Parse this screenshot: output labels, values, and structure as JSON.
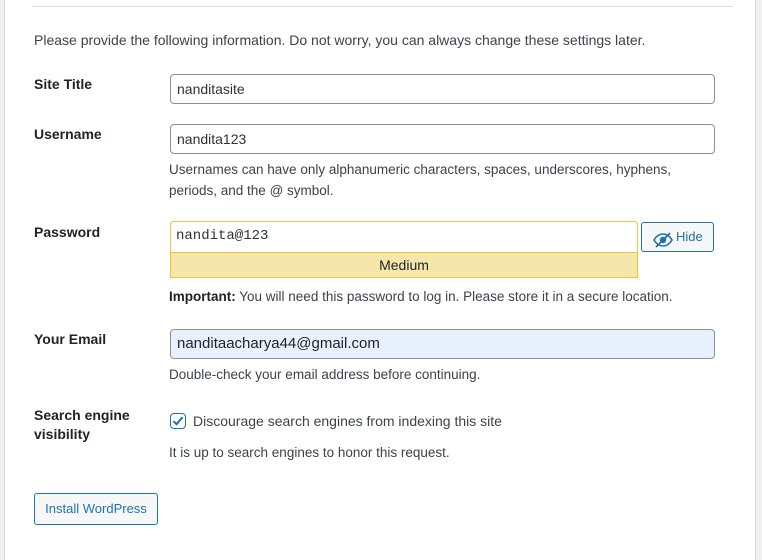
{
  "intro": "Please provide the following information. Do not worry, you can always change these settings later.",
  "site_title": {
    "label": "Site Title",
    "value": "nanditasite"
  },
  "username": {
    "label": "Username",
    "value": "nandita123",
    "description_line1": "Usernames can have only alphanumeric characters, spaces, underscores, hyphens,",
    "description_line2": "periods, and the @ symbol."
  },
  "password": {
    "label": "Password",
    "value": "nandita@123",
    "strength": "Medium",
    "hide_button": "Hide",
    "hide_icon": "eye-slash-icon",
    "important_label": "Important:",
    "important_text": "You will need this password to log in. Please store it in a secure location."
  },
  "email": {
    "label": "Your Email",
    "value": "nanditaacharya44@gmail.com",
    "description": "Double-check your email address before continuing."
  },
  "search_visibility": {
    "label_line1": "Search engine",
    "label_line2": "visibility",
    "checkbox_label": "Discourage search engines from indexing this site",
    "checked": true,
    "description": "It is up to search engines to honor this request."
  },
  "install_button": "Install WordPress",
  "colors": {
    "accent": "#2271b1",
    "strength_medium_bg": "#f5e6ab",
    "strength_medium_border": "#f0c33c",
    "autofill_bg": "#e8f0fe"
  }
}
